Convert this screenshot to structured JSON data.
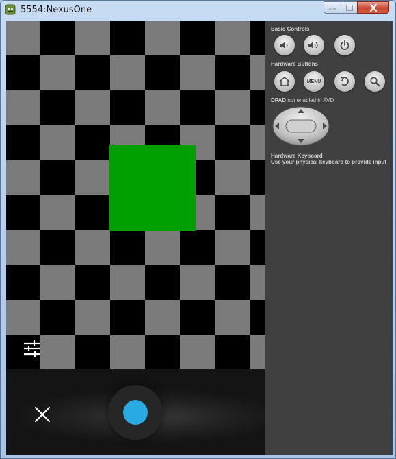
{
  "window": {
    "title": "5554:NexusOne",
    "app_icon": "android-icon",
    "controls": [
      "minimize-icon",
      "maximize-icon",
      "close-icon"
    ]
  },
  "screen": {
    "checkerboard": {
      "dark_color": "#000000",
      "light_color": "#7b7b7b"
    },
    "square_color": "#00a000",
    "filter_icon": "sliders-icon",
    "navbar": {
      "close_icon": "close-icon",
      "shutter_icon": "shutter-button",
      "shutter_color": "#2aaae2"
    }
  },
  "panel": {
    "basic_controls": {
      "label": "Basic Controls",
      "buttons": [
        "volume-down-icon",
        "volume-up-icon",
        "power-icon"
      ]
    },
    "hardware_buttons": {
      "label": "Hardware Buttons",
      "buttons": [
        "home-icon",
        "menu-button",
        "back-icon",
        "search-icon"
      ],
      "menu_label": "MENU"
    },
    "dpad": {
      "label": "DPAD",
      "sub_label": "not enabled in AVD"
    },
    "keyboard": {
      "label": "Hardware Keyboard",
      "sub_label": "Use your physical keyboard to provide input"
    }
  }
}
